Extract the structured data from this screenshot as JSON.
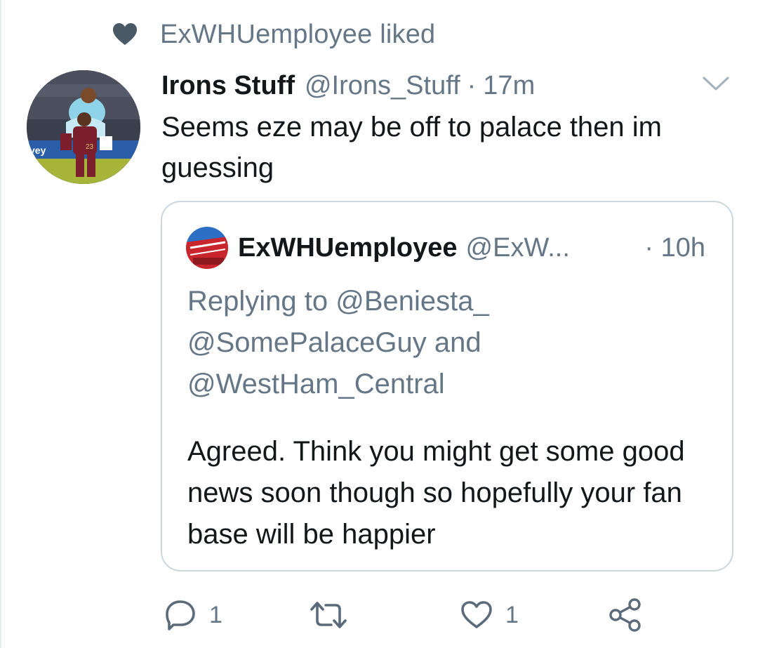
{
  "context": {
    "icon": "heart-icon",
    "text": "ExWHUemployee liked"
  },
  "tweet": {
    "display_name": "Irons Stuff",
    "handle": "@Irons_Stuff",
    "separator": "·",
    "time": "17m",
    "text": "Seems eze may be off to palace then im guessing"
  },
  "quote": {
    "display_name": "ExWHUemployee",
    "handle": "@ExW...",
    "time": "· 10h",
    "replying_to": "Replying to @Beniesta_ @SomePalaceGuy and @WestHam_Central",
    "text": "Agreed. Think you might get some good news soon though so hopefully your fan base will be happier"
  },
  "actions": {
    "reply_count": "1",
    "retweet_count": "",
    "like_count": "1"
  },
  "colors": {
    "text_primary": "#14171a",
    "text_secondary": "#657786",
    "border": "#ccd6dd",
    "icon_gray": "#5b6b79"
  }
}
